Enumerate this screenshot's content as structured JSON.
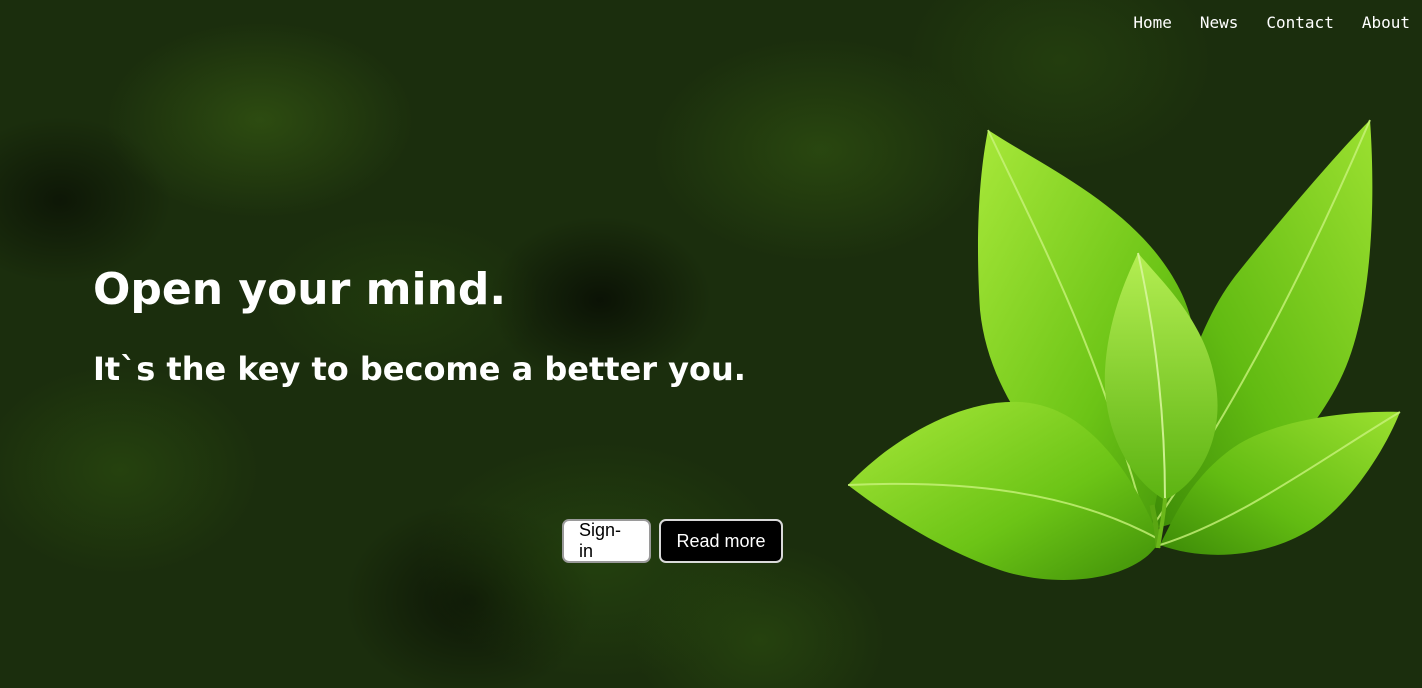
{
  "nav": {
    "items": [
      {
        "label": "Home"
      },
      {
        "label": "News"
      },
      {
        "label": "Contact"
      },
      {
        "label": "About"
      }
    ]
  },
  "hero": {
    "headline": "Open your mind.",
    "subline": "It`s the key to become a better you.",
    "buttons": {
      "signin_label": "Sign-in",
      "readmore_label": "Read more"
    }
  },
  "colors": {
    "background": "#1b2e0d",
    "leaf_light": "#8fd92a",
    "leaf_dark": "#4ea10d",
    "text": "#ffffff"
  },
  "icons": {
    "hero_image": "green-leaves-icon"
  }
}
